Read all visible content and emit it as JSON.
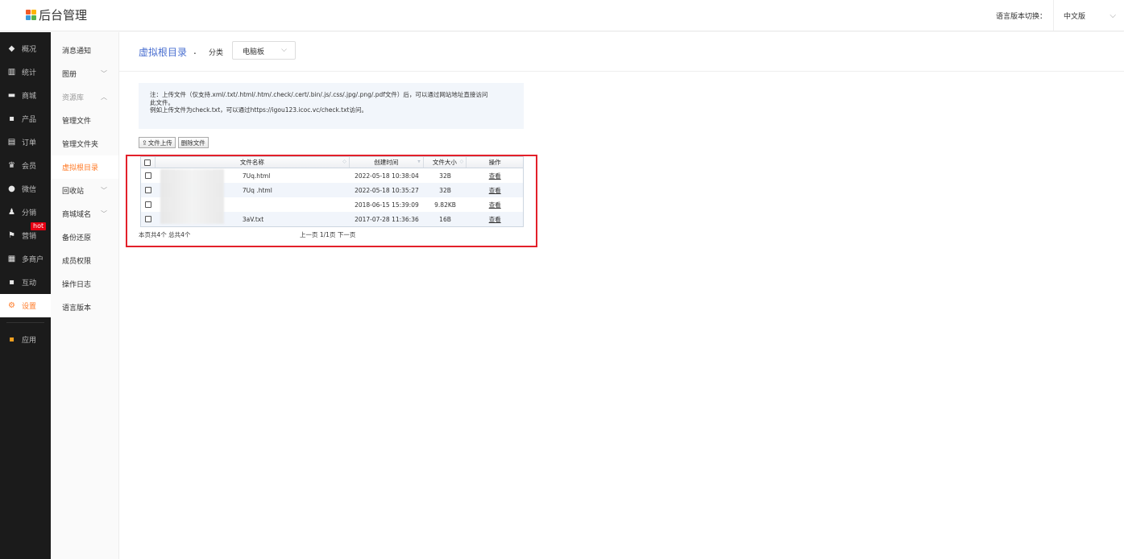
{
  "app": {
    "title": "后台管理",
    "logo_colors": [
      "#f05a28",
      "#ffb400",
      "#3a9bdc",
      "#55b24b"
    ]
  },
  "header": {
    "lang_label": "语言版本切换：",
    "lang_value": "中文版"
  },
  "leftnav": {
    "items": [
      {
        "label": "概况",
        "icon": "layers-icon"
      },
      {
        "label": "统计",
        "icon": "chart-icon"
      },
      {
        "label": "商城",
        "icon": "shop-icon"
      },
      {
        "label": "产品",
        "icon": "grid-icon"
      },
      {
        "label": "订单",
        "icon": "order-icon"
      },
      {
        "label": "会员",
        "icon": "crown-icon"
      },
      {
        "label": "微信",
        "icon": "wechat-icon"
      },
      {
        "label": "分销",
        "icon": "people-icon"
      },
      {
        "label": "营销",
        "icon": "flag-icon"
      },
      {
        "label": "多商户",
        "icon": "store-icon"
      },
      {
        "label": "互动",
        "icon": "grid-icon"
      },
      {
        "label": "设置",
        "icon": "gear-icon"
      }
    ],
    "hot_badge": "hot",
    "app_item": "应用"
  },
  "subnav": {
    "items": [
      {
        "label": "消息通知"
      },
      {
        "label": "图册"
      },
      {
        "label": "资源库"
      },
      {
        "label": "管理文件"
      },
      {
        "label": "管理文件夹"
      },
      {
        "label": "虚拟根目录"
      },
      {
        "label": "回收站"
      },
      {
        "label": "商城域名"
      },
      {
        "label": "备份还原"
      },
      {
        "label": "成员权限"
      },
      {
        "label": "操作日志"
      },
      {
        "label": "语言版本"
      }
    ]
  },
  "main": {
    "title": "虚拟根目录",
    "title_dot": ".",
    "category_label": "分类",
    "category_value": "电脑板",
    "note_line1": "注：上传文件（仅支持.xml/.txt/.html/.htm/.check/.cert/.bin/.js/.css/.jpg/.png/.pdf文件）后，可以通过网站地址直接访问",
    "note_line2": "此文件。",
    "note_line3": "例如上传文件为check.txt，可以通过https://igou123.icoc.vc/check.txt访问。",
    "upload_button": "文件上传",
    "delete_button": "删除文件",
    "table": {
      "headers": [
        "文件名称",
        "创建时间",
        "文件大小",
        "操作"
      ],
      "rows": [
        {
          "name": "7Uq.html",
          "created": "2022-05-18 10:38:04",
          "size": "32B",
          "action": "查看"
        },
        {
          "name": "7Uq .html",
          "created": "2022-05-18 10:35:27",
          "size": "32B",
          "action": "查看"
        },
        {
          "name": "",
          "created": "2018-06-15 15:39:09",
          "size": "9.82KB",
          "action": "查看"
        },
        {
          "name": "3aV.txt",
          "created": "2017-07-28 11:36:36",
          "size": "16B",
          "action": "查看"
        }
      ]
    },
    "footer_count": "本页共4个 总共4个",
    "pager": "上一页 1/1页 下一页"
  },
  "accent_color": "#ff7b28",
  "highlight_color": "#e3202a"
}
